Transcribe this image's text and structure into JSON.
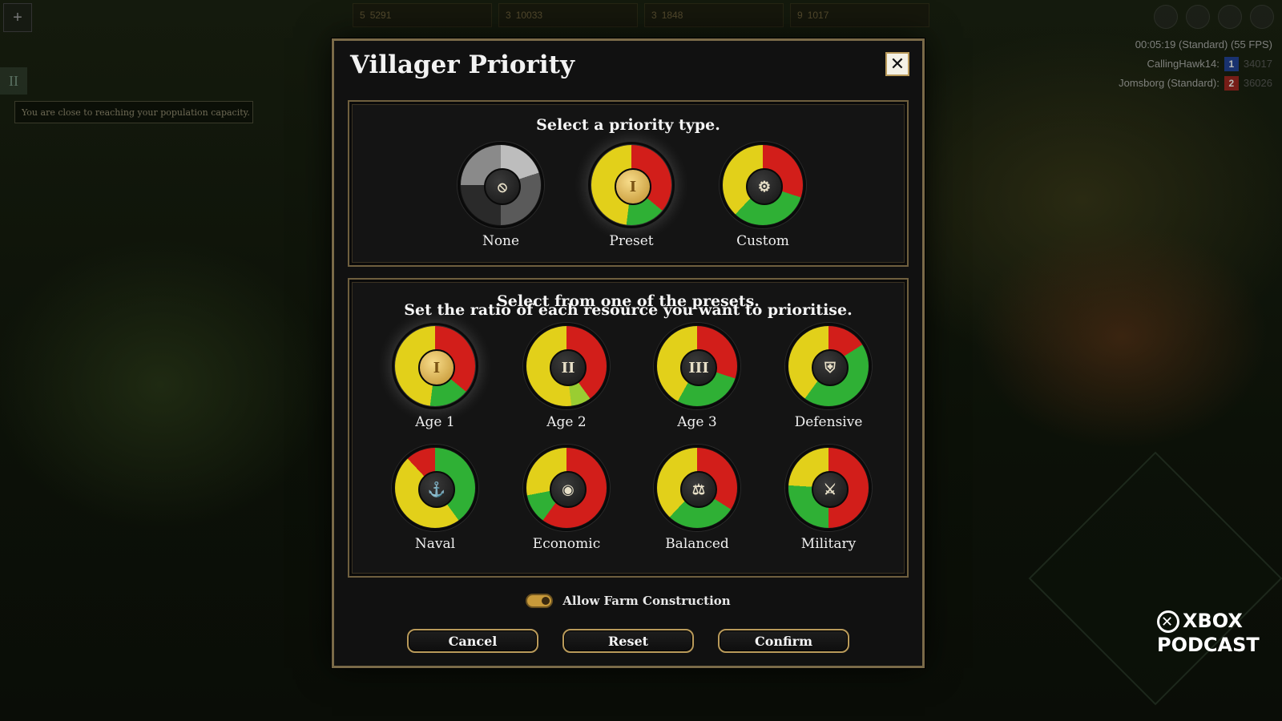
{
  "hud": {
    "timer": "00:05:19 (Standard) (55 FPS)",
    "players": [
      {
        "name": "CallingHawk14:",
        "team": "1",
        "score": "34017"
      },
      {
        "name": "Jomsborg (Standard):",
        "team": "2",
        "score": "36026"
      }
    ],
    "resources": [
      "5",
      "5291",
      "3",
      "10033",
      "3",
      "1848",
      "9",
      "1017"
    ],
    "notice": "You are close to reaching your population capacity."
  },
  "dialog": {
    "title": "Villager Priority",
    "priority_heading": "Select a priority type.",
    "priority_types": [
      {
        "label": "None",
        "icon": "none-icon",
        "glyph": "⦸"
      },
      {
        "label": "Preset",
        "icon": "roman-numeral-one-icon",
        "glyph": "I"
      },
      {
        "label": "Custom",
        "icon": "gear-icon",
        "glyph": "⚙"
      }
    ],
    "presets_heading": "Select from one of the presets.",
    "presets_subheading": "Set the ratio of each resource you want to prioritise.",
    "presets": [
      {
        "label": "Age 1",
        "icon": "roman-numeral-one-icon",
        "glyph": "I"
      },
      {
        "label": "Age 2",
        "icon": "roman-numeral-two-icon",
        "glyph": "II"
      },
      {
        "label": "Age 3",
        "icon": "roman-numeral-three-icon",
        "glyph": "III"
      },
      {
        "label": "Defensive",
        "icon": "shield-icon",
        "glyph": "⛨"
      },
      {
        "label": "Naval",
        "icon": "anchor-icon",
        "glyph": "⚓"
      },
      {
        "label": "Economic",
        "icon": "coins-icon",
        "glyph": "◉"
      },
      {
        "label": "Balanced",
        "icon": "scales-icon",
        "glyph": "⚖"
      },
      {
        "label": "Military",
        "icon": "sword-icon",
        "glyph": "⚔"
      }
    ],
    "toggle_label": "Allow Farm Construction",
    "toggle_on": true,
    "buttons": {
      "cancel": "Cancel",
      "reset": "Reset",
      "confirm": "Confirm"
    }
  },
  "watermark": {
    "line1": "XBOX",
    "line2": "PODCAST"
  },
  "colors": {
    "food": "#c9201c",
    "wood": "#2fa52f",
    "gold": "#e8d21c",
    "accent": "#b99a5a"
  }
}
